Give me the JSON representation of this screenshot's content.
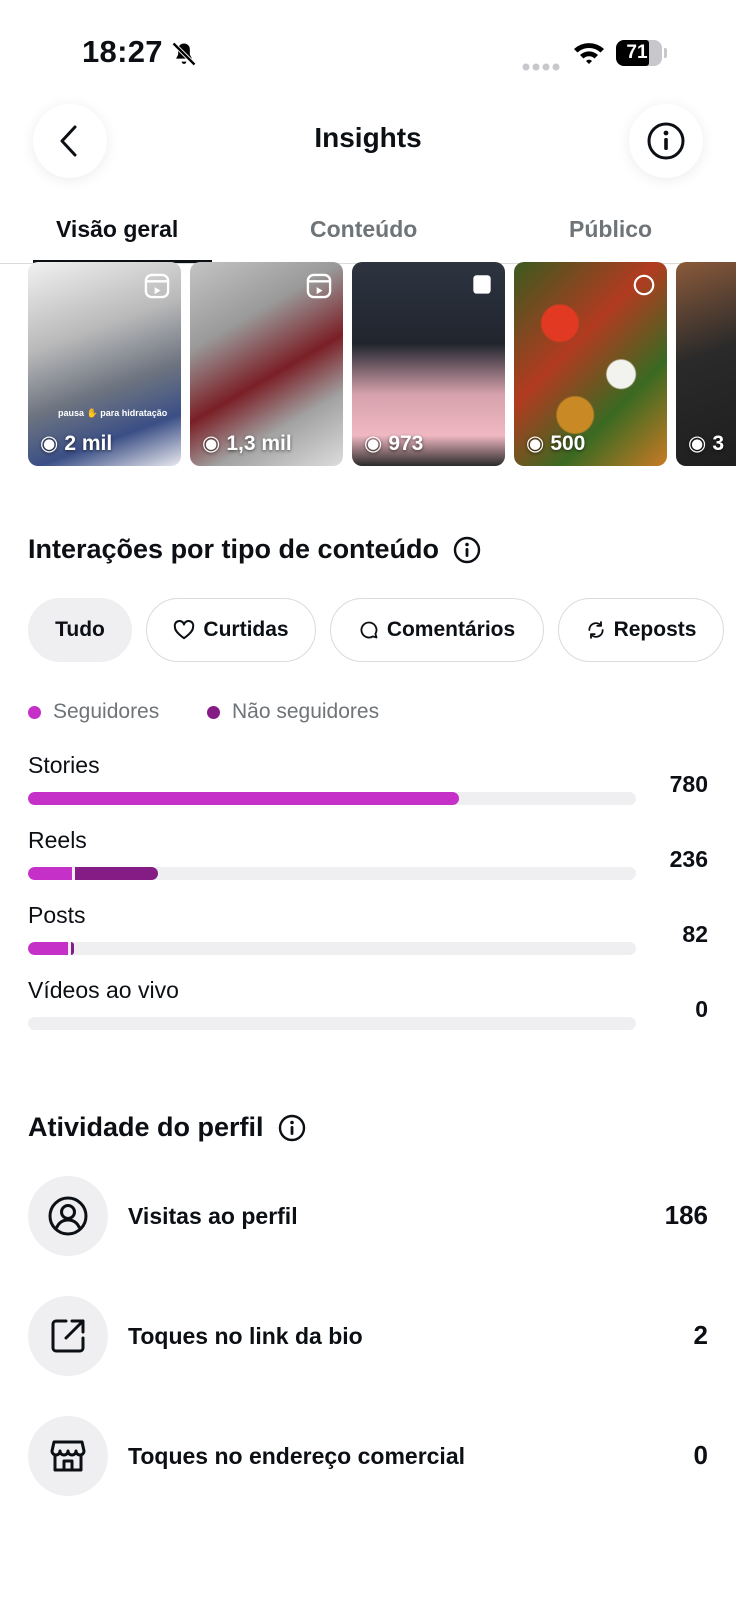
{
  "status_bar": {
    "time": "18:27",
    "battery": "71"
  },
  "header": {
    "title": "Insights"
  },
  "tabs": [
    {
      "label": "Visão geral",
      "active": true
    },
    {
      "label": "Conteúdo",
      "active": false
    },
    {
      "label": "Público",
      "active": false
    }
  ],
  "thumbnails": [
    {
      "views": "2 mil",
      "type": "reel",
      "caption": "pausa ✋ para hidratação"
    },
    {
      "views": "1,3 mil",
      "type": "reel"
    },
    {
      "views": "973",
      "type": "story"
    },
    {
      "views": "500",
      "type": "carousel"
    },
    {
      "views": "3",
      "type": "post"
    }
  ],
  "interactions": {
    "title": "Interações por tipo de conteúdo",
    "chips": [
      {
        "label": "Tudo",
        "icon": "none",
        "active": true
      },
      {
        "label": "Curtidas",
        "icon": "heart-icon",
        "active": false
      },
      {
        "label": "Comentários",
        "icon": "comment-icon",
        "active": false
      },
      {
        "label": "Reposts",
        "icon": "repost-icon",
        "active": false
      }
    ],
    "legend": [
      {
        "label": "Seguidores",
        "color": "#c530c9"
      },
      {
        "label": "Não seguidores",
        "color": "#851b85"
      }
    ],
    "chart_data": {
      "type": "bar",
      "orientation": "horizontal",
      "stacked": true,
      "categories": [
        "Stories",
        "Reels",
        "Posts",
        "Vídeos ao vivo"
      ],
      "totals": [
        "780",
        "236",
        "82",
        "0"
      ],
      "max": 1100,
      "series": [
        {
          "name": "Seguidores",
          "color": "#c530c9",
          "values": [
            780,
            80,
            72,
            0
          ]
        },
        {
          "name": "Não seguidores",
          "color": "#851b85",
          "values": [
            0,
            156,
            10,
            0
          ]
        }
      ]
    }
  },
  "profile_activity": {
    "title": "Atividade do perfil",
    "items": [
      {
        "label": "Visitas ao perfil",
        "value": "186",
        "icon": "user-circle-icon"
      },
      {
        "label": "Toques no link da bio",
        "value": "2",
        "icon": "external-link-icon"
      },
      {
        "label": "Toques no endereço comercial",
        "value": "0",
        "icon": "storefront-icon"
      }
    ]
  }
}
